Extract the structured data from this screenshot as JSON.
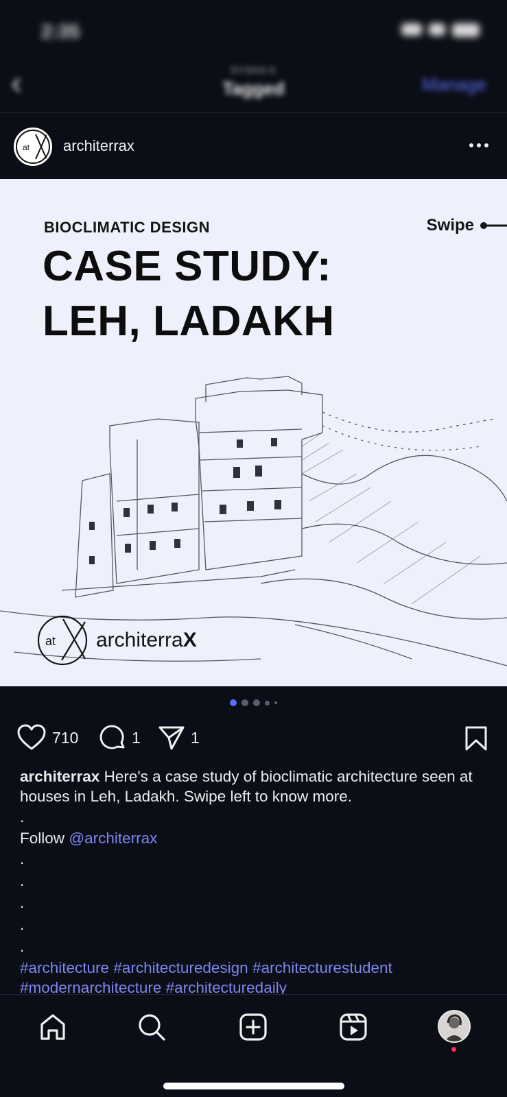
{
  "status_bar": {
    "time": "2:35"
  },
  "top_nav": {
    "subtitle": "SYSHA K",
    "title": "Tagged",
    "manage_label": "Manage"
  },
  "post": {
    "username": "architerrax",
    "avatar_text": "atX",
    "image": {
      "kicker": "BIOCLIMATIC DESIGN",
      "title_line1": "CASE STUDY:",
      "title_line2": "LEH, LADAKH",
      "swipe_label": "Swipe",
      "brand_text": "architerra",
      "brand_x": "X",
      "brand_mark_text": "atX"
    },
    "carousel": {
      "total": 5,
      "active": 1
    },
    "likes": "710",
    "comments": "1",
    "shares": "1",
    "caption": {
      "user": "architerrax",
      "text": "Here's a case study of bioclimatic architecture seen at houses in Leh, Ladakh. Swipe left to know more.",
      "follow_label": "Follow",
      "mention": "@architerrax",
      "dot": ".",
      "hashtags_line1": "#architecture #architecturedesign #architecturestudent",
      "hashtags_line2": "#modernarchitecture #architecturedaily"
    }
  },
  "colors": {
    "background": "#0b0e17",
    "accent": "#7e86ee",
    "active_dot": "#5b6ef5",
    "notification_dot": "#ff2d55"
  },
  "tab_bar": {
    "tabs": [
      {
        "name": "home-icon"
      },
      {
        "name": "search-icon"
      },
      {
        "name": "create-icon"
      },
      {
        "name": "reels-icon"
      },
      {
        "name": "profile-avatar"
      }
    ]
  }
}
